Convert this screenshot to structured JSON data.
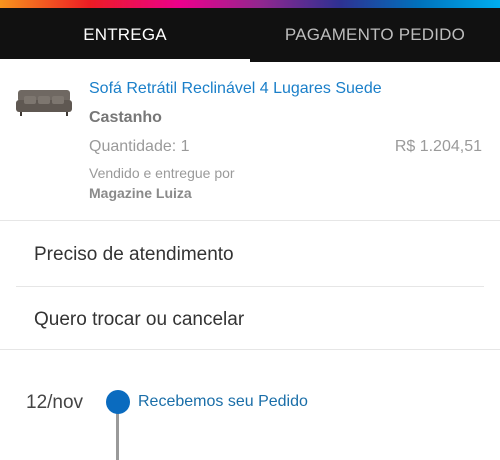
{
  "tabs": {
    "delivery": "ENTREGA",
    "payment": "PAGAMENTO PEDIDO"
  },
  "product": {
    "image_icon": "sofa-icon",
    "title": "Sofá Retrátil Reclinável 4 Lugares Suede",
    "color": "Castanho",
    "quantity": "Quantidade: 1",
    "price": "R$ 1.204,51",
    "sold_by": "Vendido e entregue por",
    "seller": "Magazine Luiza"
  },
  "menu": {
    "support": "Preciso de atendimento",
    "exchange": "Quero trocar ou cancelar"
  },
  "timeline": {
    "date": "12/nov",
    "status": "Recebemos seu Pedido"
  },
  "colors": {
    "link": "#1a7fc9",
    "header": "#111111",
    "timeline_dot": "#0a6bbf"
  }
}
